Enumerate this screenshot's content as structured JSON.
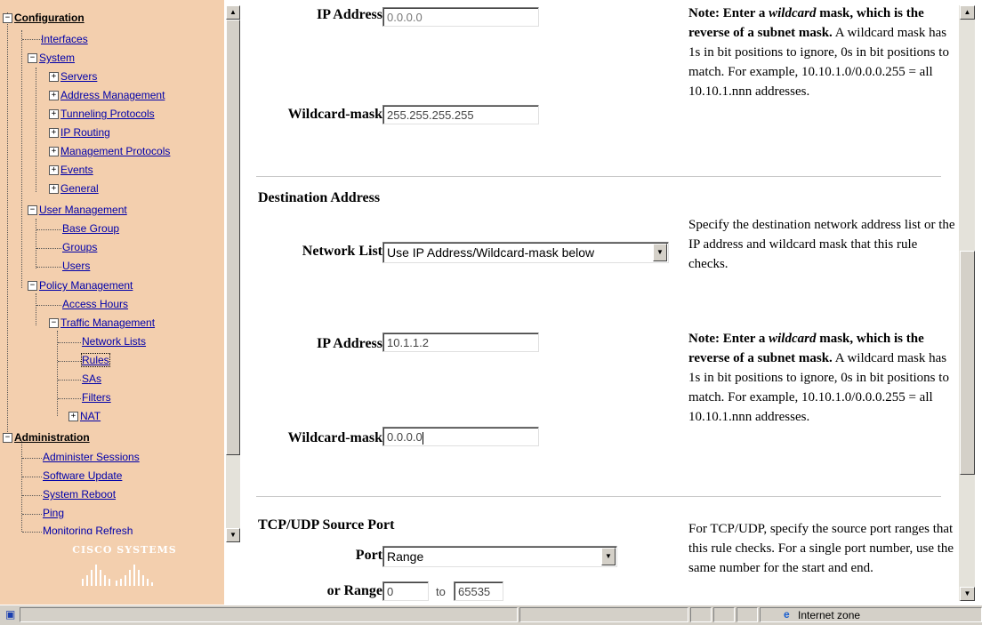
{
  "nav": {
    "items": [
      {
        "label": "Configuration",
        "bold": true
      },
      {
        "label": "Interfaces"
      },
      {
        "label": "System"
      },
      {
        "label": "Servers"
      },
      {
        "label": "Address Management"
      },
      {
        "label": "Tunneling Protocols"
      },
      {
        "label": "IP Routing"
      },
      {
        "label": "Management Protocols"
      },
      {
        "label": "Events"
      },
      {
        "label": "General"
      },
      {
        "label": "User Management"
      },
      {
        "label": "Base Group"
      },
      {
        "label": "Groups"
      },
      {
        "label": "Users"
      },
      {
        "label": "Policy Management"
      },
      {
        "label": "Access Hours"
      },
      {
        "label": "Traffic Management"
      },
      {
        "label": "Network Lists"
      },
      {
        "label": "Rules"
      },
      {
        "label": "SAs"
      },
      {
        "label": "Filters"
      },
      {
        "label": "NAT"
      },
      {
        "label": "Administration",
        "bold": true
      },
      {
        "label": "Administer Sessions"
      },
      {
        "label": "Software Update"
      },
      {
        "label": "System Reboot"
      },
      {
        "label": "Ping"
      },
      {
        "label": "Monitoring Refresh"
      }
    ],
    "logo_text": "Cisco Systems"
  },
  "source": {
    "ip_label": "IP Address",
    "ip_value": "0.0.0.0",
    "wildcard_label": "Wildcard-mask",
    "wildcard_value": "255.255.255.255",
    "note_bold": "Note: Enter a ",
    "note_italic": "wildcard",
    "note_bold2": " mask, which is the reverse of a subnet mask.",
    "note_rest": " A wildcard mask has 1s in bit positions to ignore, 0s in bit positions to match. For example, 10.10.1.0/0.0.0.255 = all 10.10.1.nnn addresses."
  },
  "destination": {
    "title": "Destination Address",
    "network_list_label": "Network List",
    "network_list_value": "Use IP Address/Wildcard-mask below",
    "help": "Specify the destination network address list or the IP address and wildcard mask that this rule checks.",
    "ip_label": "IP Address",
    "ip_value": "10.1.1.2",
    "wildcard_label": "Wildcard-mask",
    "wildcard_value": "0.0.0.0",
    "note_bold": "Note: Enter a ",
    "note_italic": "wildcard",
    "note_bold2": " mask, which is the reverse of a subnet mask.",
    "note_rest": " A wildcard mask has 1s in bit positions to ignore, 0s in bit positions to match. For example, 10.10.1.0/0.0.0.255 = all 10.10.1.nnn addresses."
  },
  "tcp": {
    "title": "TCP/UDP Source Port",
    "port_label": "Port",
    "port_value": "Range",
    "range_label": "or Range",
    "range_from": "0",
    "range_to_label": "to",
    "range_to": "65535",
    "help": "For TCP/UDP, specify the source port ranges that this rule checks. For a single port number, use the same number for the start and end."
  },
  "statusbar": {
    "zone": "Internet zone"
  },
  "colors": {
    "nav_bg": "#f3cfae",
    "link": "#0000aa",
    "chrome": "#d4d0c8"
  }
}
